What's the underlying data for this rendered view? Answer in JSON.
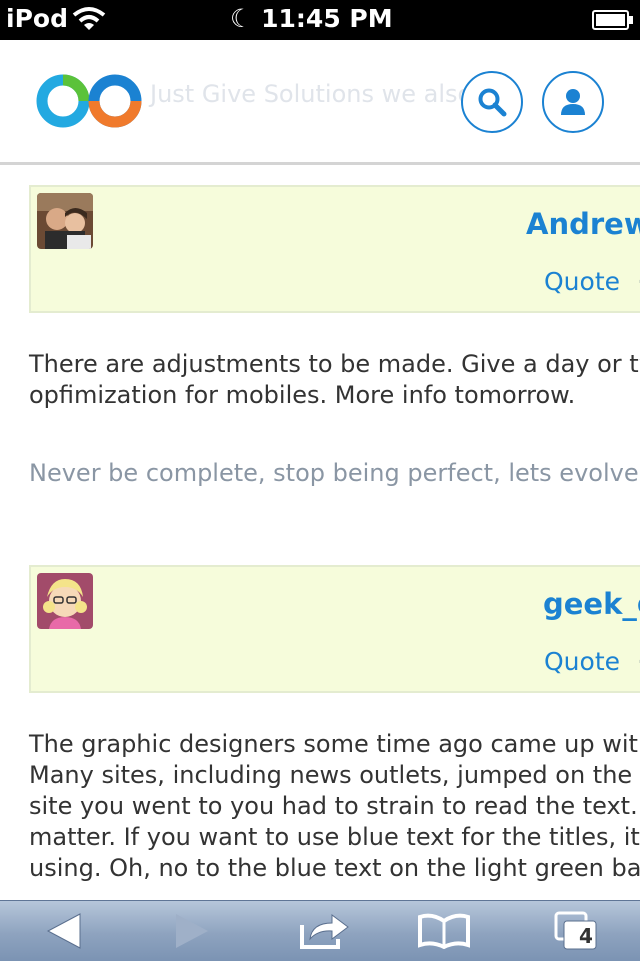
{
  "status_bar": {
    "device": "iPod",
    "time": "11:45 PM"
  },
  "header": {
    "tagline": "Just Give Solutions we also... w",
    "icons": [
      "logo-icon",
      "search-icon",
      "user-icon"
    ]
  },
  "posts": [
    {
      "author": "Andrew",
      "quote_label": "Quote",
      "separator": "·",
      "body": [
        "There are adjustments to be made. Give a day or two",
        "opfimization for mobiles. More info tomorrow."
      ],
      "signature": "Never be complete, stop being perfect, lets evolve, le"
    },
    {
      "author": "geek_g",
      "quote_label": "Quote",
      "separator": "·",
      "body": [
        "The graphic designers some time ago came up with t",
        "Many sites, including news outlets, jumped on the w",
        "site you went to you had to strain to read the text.  T",
        "matter.  If you want to use blue text for the titles, it m",
        "using.  Oh, no to the blue text on the light green back"
      ]
    }
  ],
  "toolbar": {
    "tabs_count": "4",
    "icons": [
      "back-icon",
      "forward-icon",
      "share-icon",
      "bookmarks-icon",
      "tabs-icon"
    ]
  },
  "colors": {
    "accent": "#1b82d2",
    "post_header_bg": "#f6fcdb",
    "signature": "#8a96a4",
    "toolbar": "#8ea3bf"
  }
}
